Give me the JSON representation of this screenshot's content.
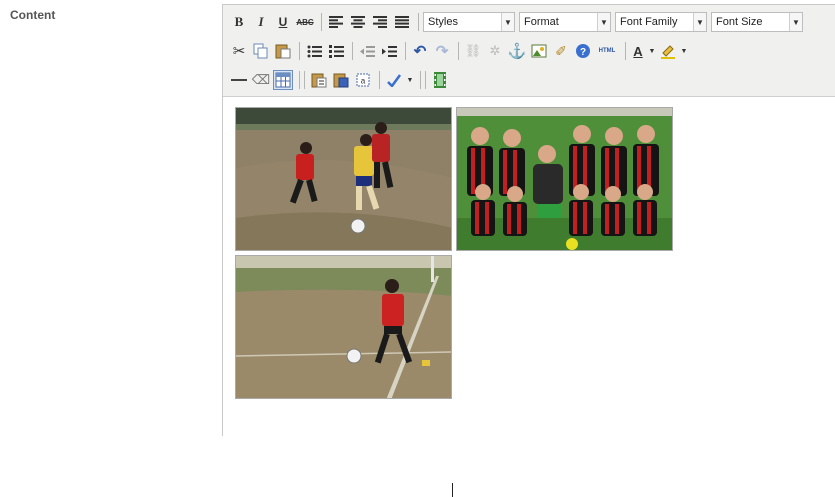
{
  "field": {
    "label": "Content"
  },
  "toolbar": {
    "bold": "B",
    "italic": "I",
    "underline": "U",
    "strike": "ABC",
    "styles": "Styles",
    "format": "Format",
    "font_family": "Font Family",
    "font_size": "Font Size",
    "html": "HTML",
    "text_color": "A"
  },
  "colors": {
    "toolbar_bg": "#f0f0ee",
    "border": "#c9c9c9",
    "active_button": "#d9e4f2"
  }
}
